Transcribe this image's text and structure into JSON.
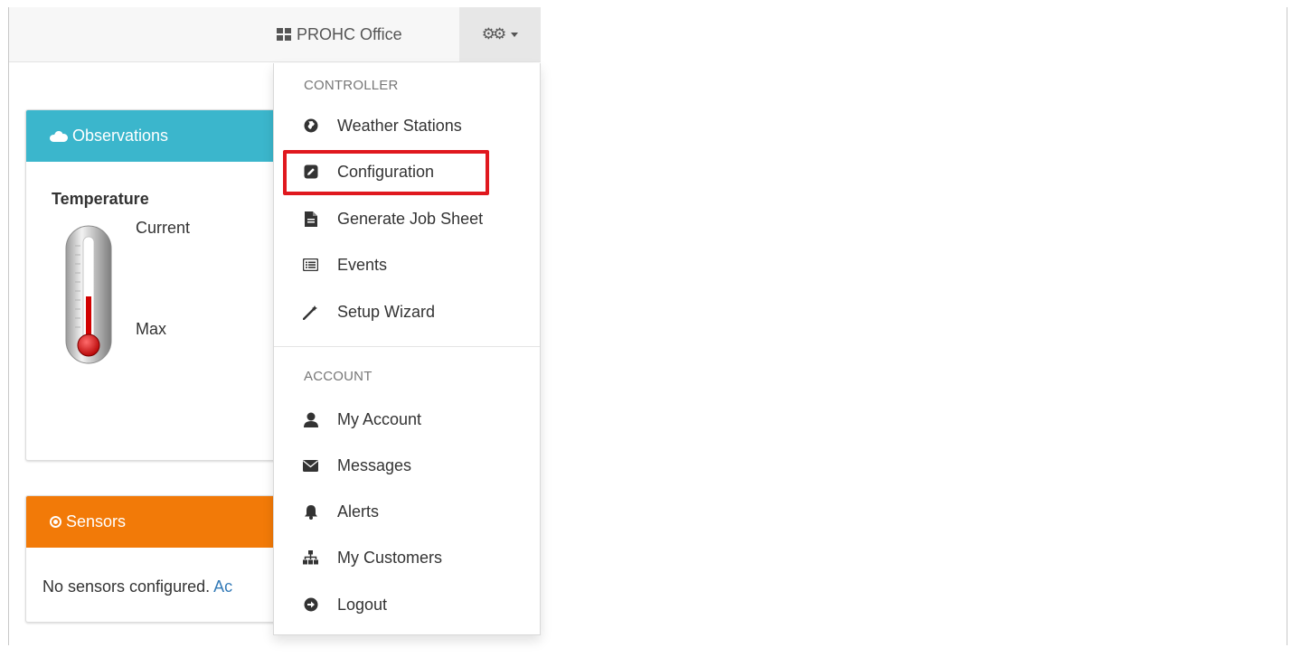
{
  "navbar": {
    "office_label": "PROHC Office",
    "office_icon": "grid-icon",
    "settings_icon": "cogs-icon"
  },
  "observations": {
    "heading": "Observations",
    "icon": "cloud-icon",
    "accent": "#3bb6cc",
    "temperature_title": "Temperature",
    "current_label": "Current",
    "max_label": "Max",
    "thermometer_fill": 0.45
  },
  "sensors": {
    "heading": "Sensors",
    "icon": "bullseye-icon",
    "accent": "#f27a08",
    "empty_text": "No sensors configured.",
    "link_text": "Ac"
  },
  "dropdown": {
    "controller_header": "CONTROLLER",
    "account_header": "ACCOUNT",
    "controller_items": [
      {
        "label": "Weather Stations",
        "icon": "globe-icon"
      },
      {
        "label": "Configuration",
        "icon": "edit-icon"
      },
      {
        "label": "Generate Job Sheet",
        "icon": "file-icon"
      },
      {
        "label": "Events",
        "icon": "list-alt-icon"
      },
      {
        "label": "Setup Wizard",
        "icon": "magic-wand-icon"
      }
    ],
    "account_items": [
      {
        "label": "My Account",
        "icon": "user-icon"
      },
      {
        "label": "Messages",
        "icon": "envelope-icon"
      },
      {
        "label": "Alerts",
        "icon": "bell-icon"
      },
      {
        "label": "My Customers",
        "icon": "sitemap-icon"
      },
      {
        "label": "Logout",
        "icon": "logout-icon"
      }
    ],
    "highlight_color": "#e0181e"
  }
}
